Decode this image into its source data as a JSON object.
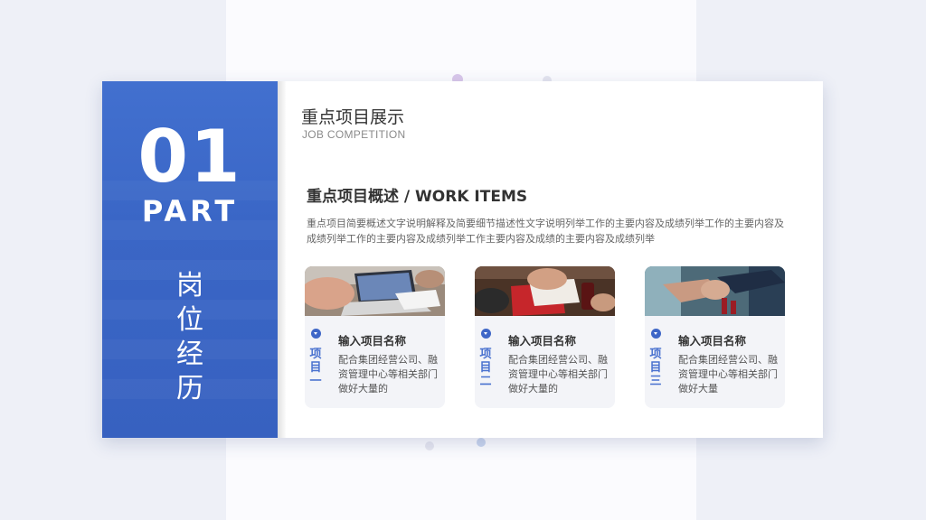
{
  "slide": {
    "number": "01",
    "part_label": "PART",
    "vertical_title": [
      "岗",
      "位",
      "经",
      "历"
    ],
    "heading": "重点项目展示",
    "heading_sub": "JOB COMPETITION",
    "section_title": "重点项目概述 / WORK ITEMS",
    "section_desc": "重点项目简要概述文字说明解释及简要细节描述性文字说明列举工作的主要内容及成绩列举工作的主要内容及成绩列举工作的主要内容及成绩列举工作主要内容及成绩的主要内容及成绩列举"
  },
  "items": [
    {
      "tag": [
        "项",
        "目",
        "一"
      ],
      "name": "输入项目名称",
      "desc": "配合集团经营公司、融资管理中心等相关部门做好大量的",
      "photo": "laptop-desk-photo"
    },
    {
      "tag": [
        "项",
        "目",
        "二"
      ],
      "name": "输入项目名称",
      "desc": "配合集团经营公司、融资管理中心等相关部门做好大量的",
      "photo": "writing-desk-photo"
    },
    {
      "tag": [
        "项",
        "目",
        "三"
      ],
      "name": "输入项目名称",
      "desc": "配合集团经营公司、融资管理中心等相关部门做好大量",
      "photo": "handshake-photo"
    }
  ],
  "colors": {
    "accent": "#3f67c7",
    "panel_top": "#4270cf",
    "panel_bottom": "#3761c0",
    "text_dark": "#333333",
    "text_muted": "#666666"
  }
}
